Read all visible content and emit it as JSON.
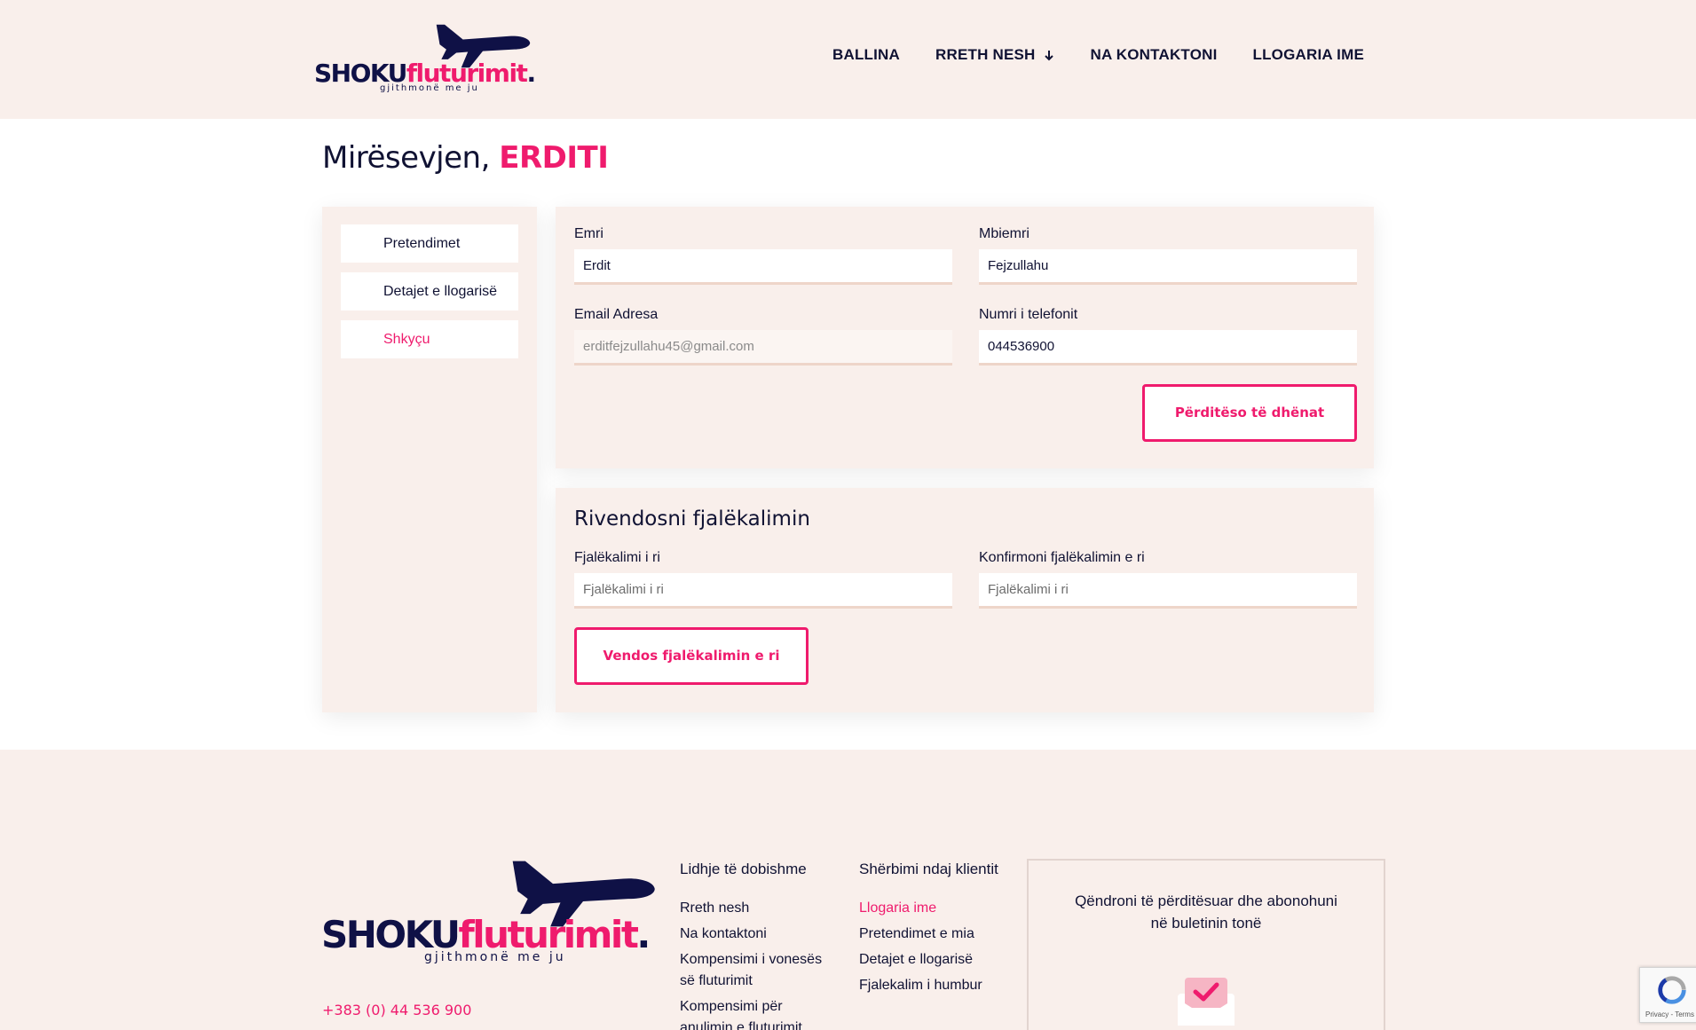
{
  "header": {
    "logo": {
      "part1": "SHOKU",
      "part2": "fluturimit",
      "dot": ".",
      "tagline": "gjithmonë me ju"
    },
    "nav": [
      {
        "label": "BALLINA"
      },
      {
        "label": "RRETH NESH"
      },
      {
        "label": "NA KONTAKTONI"
      },
      {
        "label": "LLOGARIA IME"
      }
    ]
  },
  "welcome": {
    "greeting": "Mirësevjen,",
    "name": "ERDITI"
  },
  "sidebar": {
    "items": [
      {
        "label": "Pretendimet"
      },
      {
        "label": "Detajet e llogarisë"
      },
      {
        "label": "Shkyçu"
      }
    ]
  },
  "account_form": {
    "first_name": {
      "label": "Emri",
      "value": "Erdit"
    },
    "last_name": {
      "label": "Mbiemri",
      "value": "Fejzullahu"
    },
    "email": {
      "label": "Email Adresa",
      "value": "erditfejzullahu45@gmail.com"
    },
    "phone": {
      "label": "Numri i telefonit",
      "value": "044536900"
    },
    "update_button": "Përditëso të dhënat"
  },
  "password_form": {
    "title": "Rivendosni fjalëkalimin",
    "new_password": {
      "label": "Fjalëkalimi i ri",
      "placeholder": "Fjalëkalimi i ri"
    },
    "confirm_password": {
      "label": "Konfirmoni fjalëkalimin e ri",
      "placeholder": "Fjalëkalimi i ri"
    },
    "submit_button": "Vendos fjalëkalimin e ri"
  },
  "footer": {
    "phone": "+383 (0) 44 536 900",
    "useful_links": {
      "title": "Lidhje të dobishme",
      "links": [
        "Rreth nesh",
        "Na kontaktoni",
        "Kompensimi i vonesës",
        "së fluturimit",
        "Kompensimi për",
        "anulimin e fluturimit"
      ]
    },
    "customer_service": {
      "title": "Shërbimi ndaj klientit",
      "links": [
        "Llogaria ime",
        "Pretendimet e mia",
        "Detajet e llogarisë",
        "Fjalekalim i humbur"
      ]
    },
    "newsletter": {
      "line1": "Qëndroni të përditësuar dhe abonohuni",
      "line2": "në buletinin tonë"
    }
  },
  "recaptcha": {
    "terms": "Privacy - Terms"
  },
  "colors": {
    "accent": "#ef1b6d",
    "navy": "#0f1146",
    "panel": "#f9efeb"
  }
}
